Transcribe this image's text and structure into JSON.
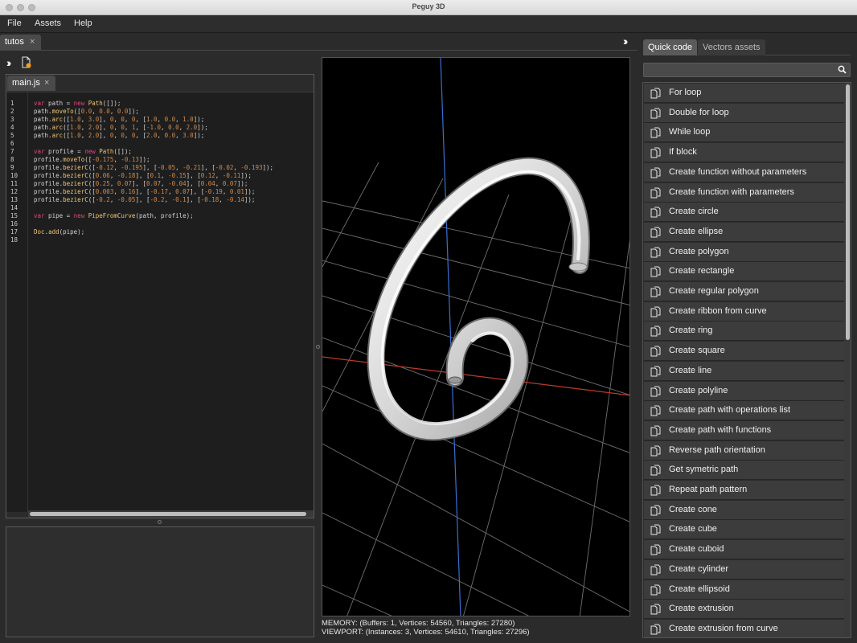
{
  "window": {
    "title": "Peguy 3D"
  },
  "menu": [
    "File",
    "Assets",
    "Help"
  ],
  "doc_tab": {
    "label": "tutos",
    "close": "×"
  },
  "file_tab": {
    "label": "main.js",
    "close": "×"
  },
  "code_lines": [
    "var path = new Path([]);",
    "path.moveTo([0.0, 0.0, 0.0]);",
    "path.arc([1.0, 3.0], 0, 0, 0, [1.0, 0.0, 1.0]);",
    "path.arc([1.0, 2.0], 0, 0, 1, [-1.0, 0.0, 2.0]);",
    "path.arc([1.0, 2.0], 0, 0, 0, [2.0, 0.0, 3.0]);",
    "",
    "var profile = new Path([]);",
    "profile.moveTo([-0.175, -0.13]);",
    "profile.bezierC([-0.12, -0.195], [-0.05, -0.21], [-0.02, -0.193]);",
    "profile.bezierC([0.06, -0.18], [0.1, -0.15], [0.12, -0.11]);",
    "profile.bezierC([0.25, 0.07], [0.07, -0.04], [0.04, 0.07]);",
    "profile.bezierC([0.003, 0.16], [-0.17, 0.07], [-0.19, 0.01]);",
    "profile.bezierC([-0.2, -0.05], [-0.2, -0.1], [-0.18, -0.14]);",
    "",
    "var pipe = new PipeFromCurve(path, profile);",
    "",
    "Doc.add(pipe);",
    ""
  ],
  "stats": {
    "memory": "MEMORY: (Buffers: 1, Vertices: 54560, Triangles: 27280)",
    "viewport": "VIEWPORT: (Instances: 3, Vertices: 54610, Triangles: 27296)"
  },
  "right_tabs": [
    "Quick code",
    "Vectors assets"
  ],
  "search": {
    "value": "",
    "placeholder": ""
  },
  "quick_code_items": [
    "For loop",
    "Double for loop",
    "While loop",
    "If block",
    "Create function without parameters",
    "Create function with parameters",
    "Create circle",
    "Create ellipse",
    "Create polygon",
    "Create rectangle",
    "Create regular polygon",
    "Create ribbon from curve",
    "Create ring",
    "Create square",
    "Create line",
    "Create polyline",
    "Create path with operations list",
    "Create path with functions",
    "Reverse path orientation",
    "Get symetric path",
    "Repeat path pattern",
    "Create cone",
    "Create cube",
    "Create cuboid",
    "Create cylinder",
    "Create ellipsoid",
    "Create extrusion",
    "Create extrusion from curve"
  ],
  "colors": {
    "keyword": "#e0457b",
    "function": "#f0c674",
    "number": "#d08b4e",
    "x_axis": "#c0392b",
    "z_axis": "#3b6fd1"
  }
}
